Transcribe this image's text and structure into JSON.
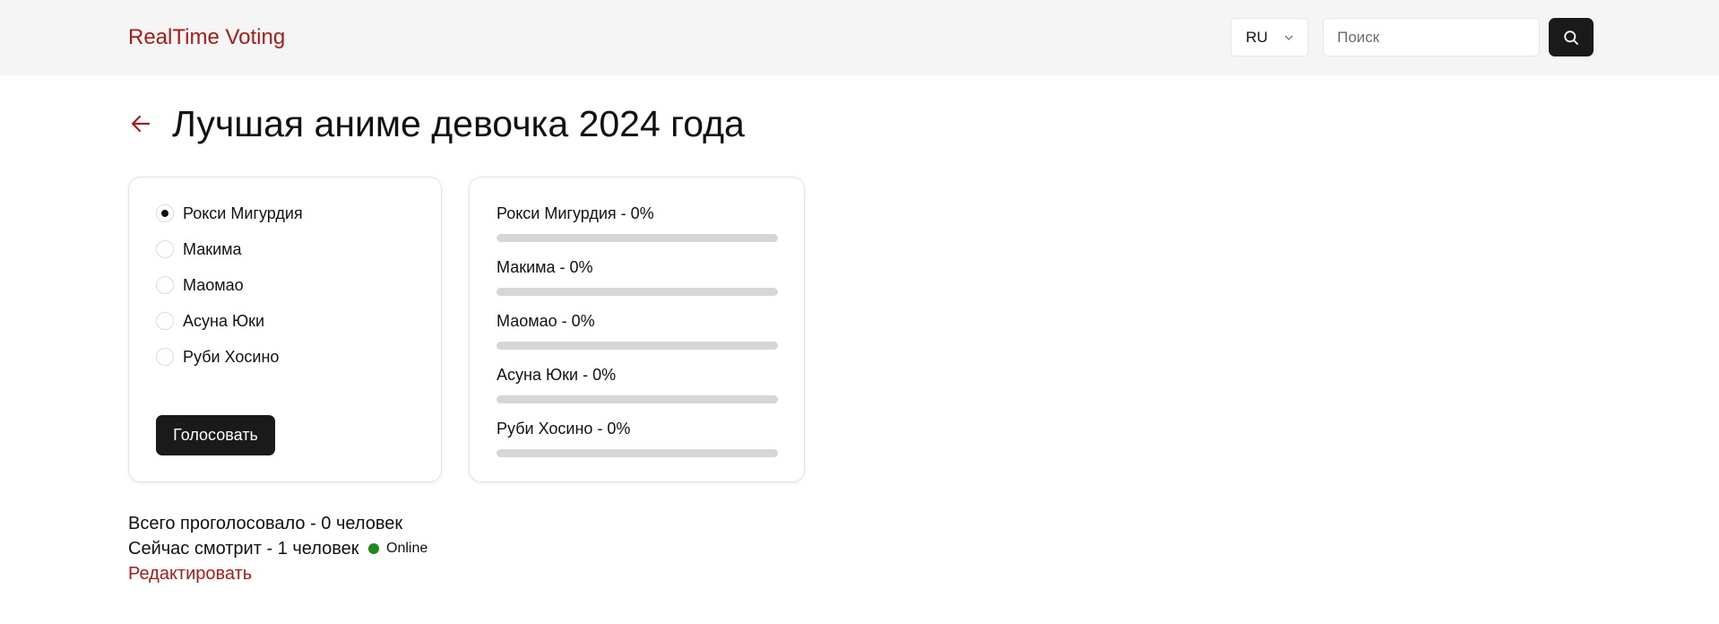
{
  "header": {
    "brand": "RealTime Voting",
    "language": "RU",
    "search_placeholder": "Поиск",
    "search_icon": "search-icon"
  },
  "page": {
    "title": "Лучшая аниме девочка 2024 года",
    "back_icon": "arrow-left-icon"
  },
  "vote": {
    "options": [
      {
        "label": "Рокси Мигурдия",
        "selected": true
      },
      {
        "label": "Макима",
        "selected": false
      },
      {
        "label": "Маомао",
        "selected": false
      },
      {
        "label": "Асуна Юки",
        "selected": false
      },
      {
        "label": "Руби Хосино",
        "selected": false
      }
    ],
    "submit_label": "Голосовать"
  },
  "results": [
    {
      "label": "Рокси Мигурдия - 0%",
      "percent": 0
    },
    {
      "label": "Макима - 0%",
      "percent": 0
    },
    {
      "label": "Маомао - 0%",
      "percent": 0
    },
    {
      "label": "Асуна Юки - 0%",
      "percent": 0
    },
    {
      "label": "Руби Хосино - 0%",
      "percent": 0
    }
  ],
  "stats": {
    "total_votes": "Всего проголосовало - 0 человек",
    "watching_now": "Сейчас смотрит - 1 человек",
    "online_label": "Online",
    "edit_label": "Редактировать"
  },
  "colors": {
    "accent": "#a51c1c",
    "dark_button": "#1a1a1a",
    "online": "#1a8a1a",
    "header_bg": "#f5f5f5"
  }
}
